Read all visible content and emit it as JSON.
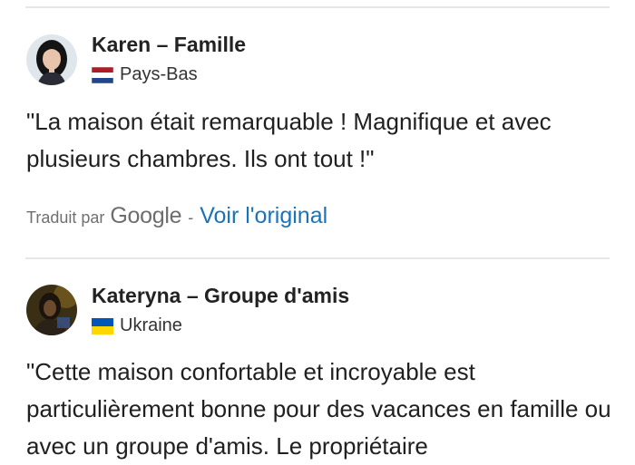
{
  "reviews": [
    {
      "name": "Karen – Famille",
      "country": "Pays-Bas",
      "flag_icon": "netherlands-flag-icon",
      "text": "\"La maison était remarquable ! Magnifique et avec plusieurs chambres. Ils ont tout !\"",
      "translated_by": "Traduit par",
      "translator_logo": "Google",
      "separator": "-",
      "original_link": "Voir l'original"
    },
    {
      "name": "Kateryna – Groupe d'amis",
      "country": "Ukraine",
      "flag_icon": "ukraine-flag-icon",
      "text": "\"Cette maison confortable et incroyable est particulièrement bonne pour des vacances en famille ou avec un groupe d'amis. Le propriétaire"
    }
  ],
  "colors": {
    "link": "#1a73b8",
    "divider": "#e6e6e6",
    "nl_red": "#ae1c28",
    "nl_blue": "#21468b",
    "ua_blue": "#0057b7",
    "ua_yellow": "#ffd700"
  }
}
